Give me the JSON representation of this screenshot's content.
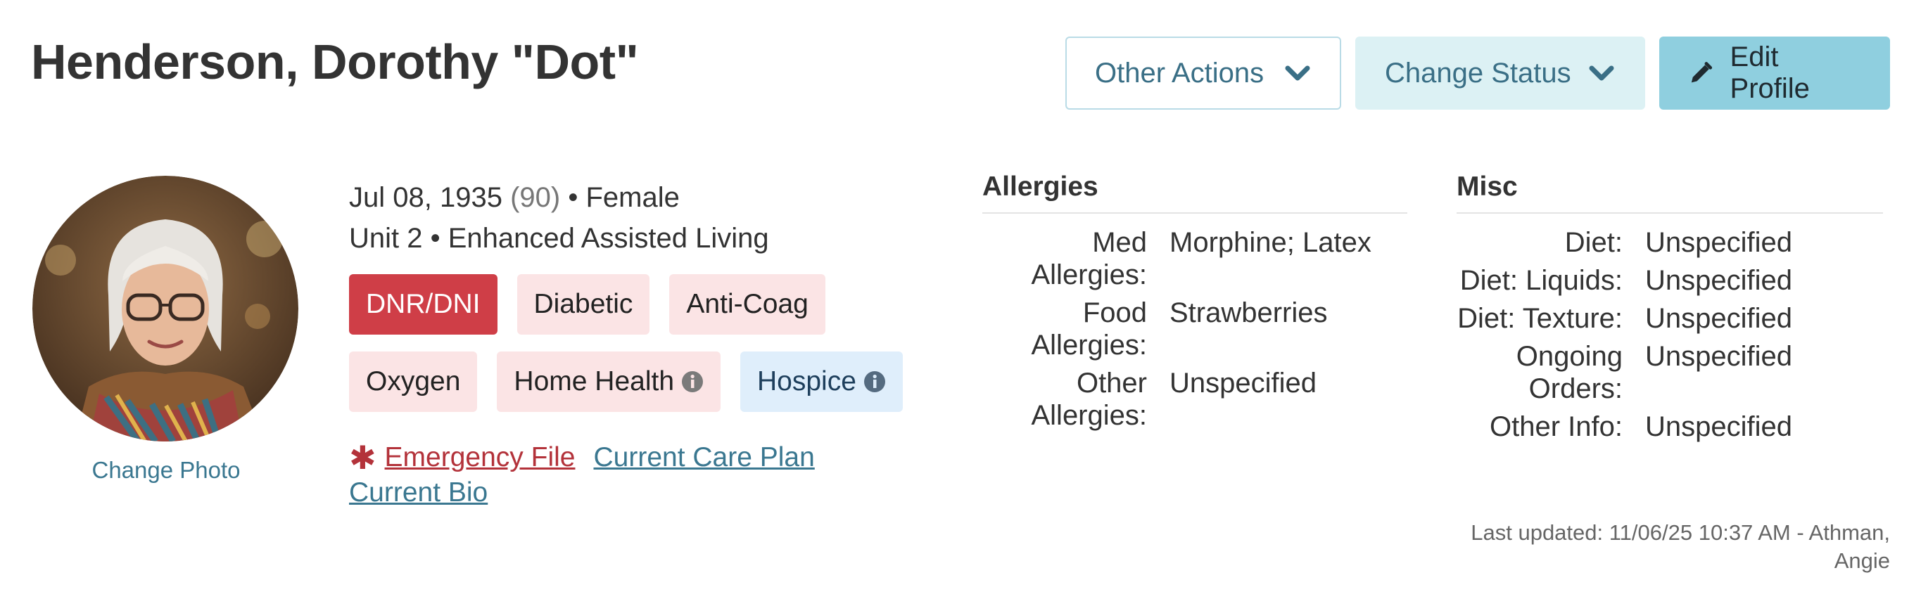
{
  "patient": {
    "name": "Henderson, Dorothy \"Dot\"",
    "dob": "Jul 08, 1935",
    "age": "(90)",
    "sex": "• Female",
    "location": "Unit 2 • Enhanced Assisted Living"
  },
  "header": {
    "other_actions_label": "Other Actions",
    "change_status_label": "Change Status",
    "edit_profile_label": "Edit Profile"
  },
  "photo": {
    "change_photo_label": "Change Photo"
  },
  "tags": [
    {
      "label": "DNR/DNI"
    },
    {
      "label": "Diabetic"
    },
    {
      "label": "Anti-Coag"
    },
    {
      "label": "Oxygen"
    },
    {
      "label": "Home Health"
    },
    {
      "label": "Hospice"
    }
  ],
  "links": {
    "emergency_file": "Emergency File",
    "current_care_plan": "Current Care Plan",
    "current_bio": "Current Bio"
  },
  "allergies": {
    "title": "Allergies",
    "rows": [
      {
        "label": "Med Allergies:",
        "value": "Morphine; Latex"
      },
      {
        "label": "Food Allergies:",
        "value": "Strawberries"
      },
      {
        "label": "Other Allergies:",
        "value": "Unspecified"
      }
    ]
  },
  "misc": {
    "title": "Misc",
    "rows": [
      {
        "label": "Diet:",
        "value": "Unspecified"
      },
      {
        "label": "Diet: Liquids:",
        "value": "Unspecified"
      },
      {
        "label": "Diet: Texture:",
        "value": "Unspecified"
      },
      {
        "label": "Ongoing Orders:",
        "value": "Unspecified"
      },
      {
        "label": "Other Info:",
        "value": "Unspecified"
      }
    ],
    "last_updated": "Last updated: 11/06/25 10:37 AM - Athman, Angie"
  },
  "colors": {
    "primary_button": "#8fcfdf",
    "danger_tag": "#cf3e47",
    "link": "#3a7790",
    "emergency_link": "#b3323a"
  },
  "icons": {
    "other_actions": "chevron-down-icon",
    "change_status": "chevron-down-icon",
    "edit_profile": "pencil-icon",
    "home_health": "info-icon",
    "hospice": "info-icon",
    "emergency_file": "asterisk-icon"
  }
}
